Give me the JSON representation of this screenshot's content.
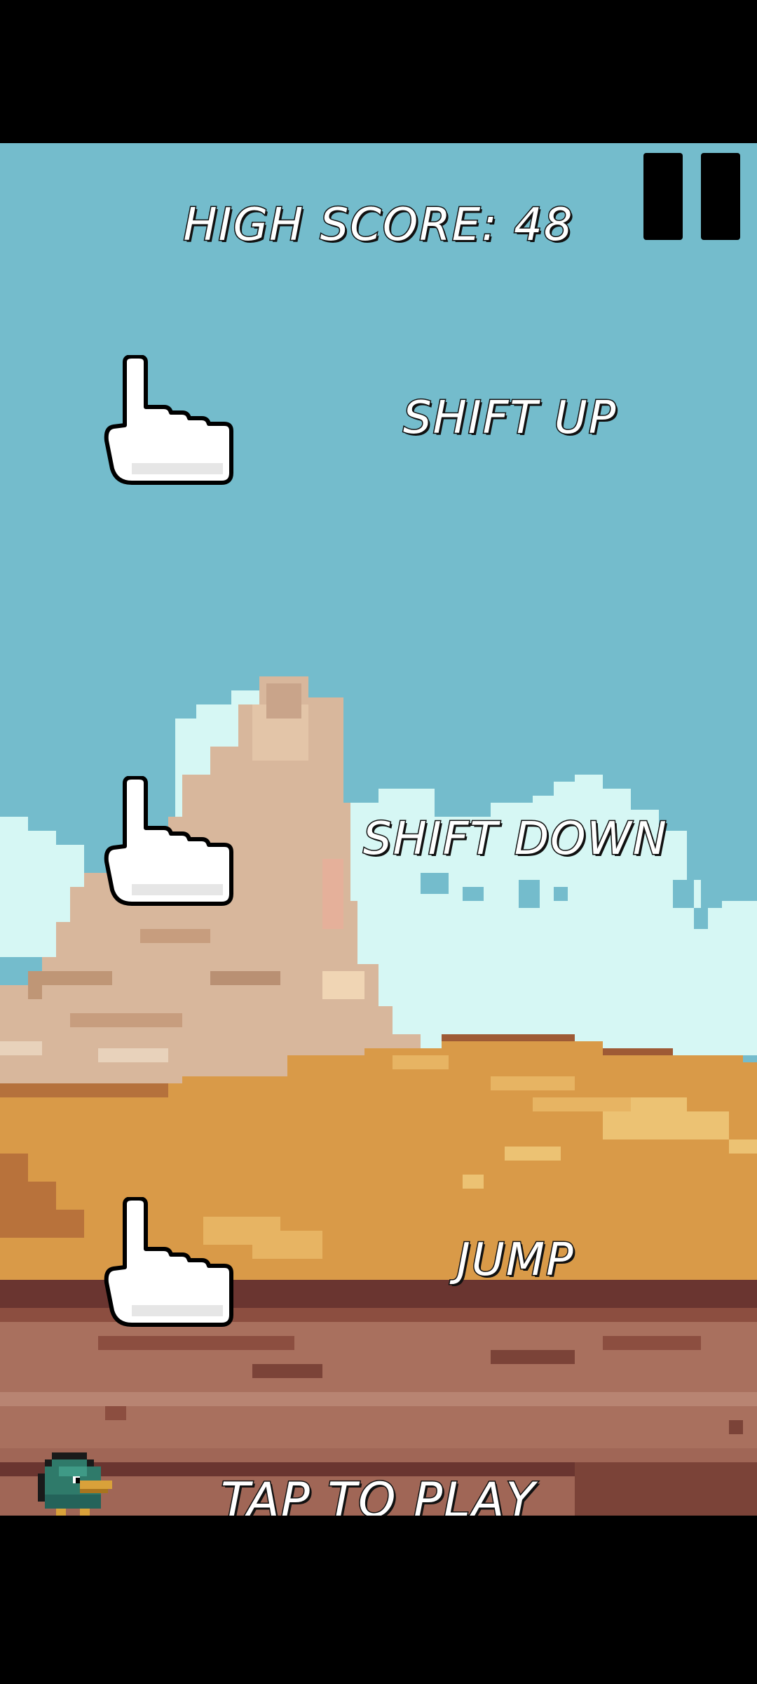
{
  "high_score": {
    "text": "HIGH SCORE: 48"
  },
  "pause": {
    "icon": "pause-icon"
  },
  "instructions": [
    {
      "icon": "pointing-hand-icon",
      "label": "SHIFT UP"
    },
    {
      "icon": "pointing-hand-icon",
      "label": "SHIFT DOWN"
    },
    {
      "icon": "pointing-hand-icon",
      "label": "JUMP"
    }
  ],
  "start": {
    "label": "TAP TO PLAY"
  },
  "player": {
    "icon": "duck-icon"
  },
  "colors": {
    "sky": "#74bccc",
    "clouds": "#d6f7f4",
    "rock": "#d8b79c",
    "sand": "#d99a48",
    "dirt": "#a9705e",
    "outline": "#111111"
  }
}
